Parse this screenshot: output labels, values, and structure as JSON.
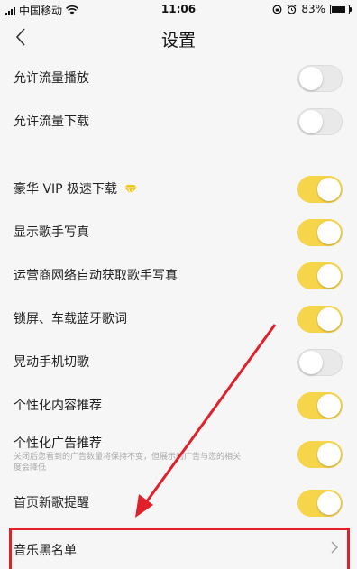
{
  "status_bar": {
    "carrier": "中国移动",
    "time": "11:06",
    "battery": "83%",
    "battery_level": 0.83
  },
  "header": {
    "back_icon": "chevron-left-icon",
    "title": "设置"
  },
  "settings": [
    {
      "label": "允许流量播放",
      "on": false
    },
    {
      "label": "允许流量下载",
      "on": false
    },
    {
      "label": "豪华 VIP 极速下载",
      "on": true,
      "badge_icon": "diamond-icon",
      "badge_color": "#f5c518"
    },
    {
      "label": "显示歌手写真",
      "on": true
    },
    {
      "label": "运营商网络自动获取歌手写真",
      "on": true
    },
    {
      "label": "锁屏、车载蓝牙歌词",
      "on": true
    },
    {
      "label": "晃动手机切歌",
      "on": false
    },
    {
      "label": "个性化内容推荐",
      "on": true
    },
    {
      "label": "个性化广告推荐",
      "on": true,
      "sub": "关闭后您看到的广告数量将保持不变，但展示的广告与您的相关度会降低"
    },
    {
      "label": "首页新歌提醒",
      "on": true
    }
  ],
  "blacklist": {
    "label": "音乐黑名单",
    "chevron_icon": "chevron-right-icon"
  },
  "colors": {
    "toggle_on": "#f7d54a",
    "toggle_off": "#e9e9e9",
    "highlight": "#e0202a"
  }
}
